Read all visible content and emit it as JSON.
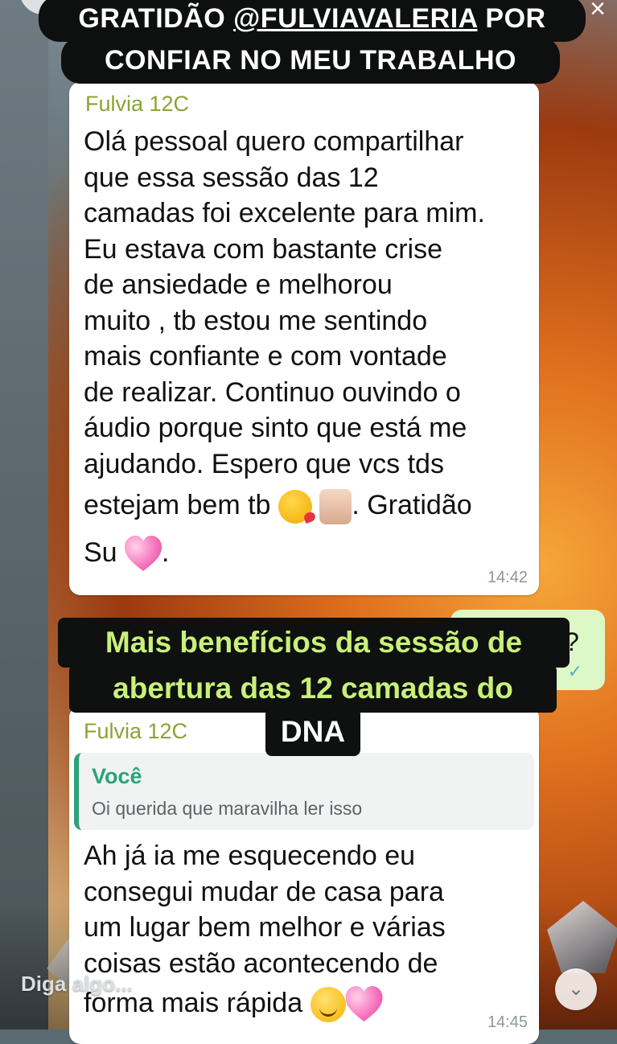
{
  "story": {
    "caption_line1_prefix": "GRATIDÃO ",
    "caption_line1_handle": "@FULVIAVALERIA",
    "caption_line1_suffix": " POR",
    "caption_line2": "CONFIAR NO MEU TRABALHO",
    "close_symbol": "×",
    "middle_caption_line1": "Mais benefícios da sessão de",
    "middle_caption_line2": "abertura das 12 camadas do",
    "middle_caption_line3": "DNA",
    "reply_placeholder": "Diga algo...",
    "scroll_down_symbol": "⌄"
  },
  "chat": {
    "message1": {
      "sender": "Fulvia 12C",
      "lines": [
        "Olá pessoal quero compartilhar",
        "que essa sessão das 12",
        "camadas foi excelente para mim.",
        "Eu estava com bastante crise",
        "de ansiedade e melhorou",
        "muito , tb estou me sentindo",
        "mais confiante e com vontade",
        "de realizar. Continuo ouvindo o",
        "áudio porque sinto que está me",
        "ajudando. Espero que vcs tds"
      ],
      "line11_before": "estejam bem tb ",
      "line11_after": ". Gratidão",
      "line12_before": "Su ",
      "line12_after": ".",
      "time": "14:42"
    },
    "outgoing_partial": {
      "tick": "✓",
      "text": "?"
    },
    "message2": {
      "sender": "Fulvia 12C",
      "quoted_name": "Você",
      "quoted_text": "Oi querida que maravilha ler isso",
      "lines": [
        "Ah já ia me esquecendo eu",
        "consegui mudar de casa para",
        "um lugar bem melhor e várias",
        "coisas estão acontecendo de"
      ],
      "line5_before": "forma mais rápida ",
      "time": "14:45"
    },
    "emoji_icons": [
      "kissing-face-icon",
      "praying-hands-icon",
      "pink-heart-icon",
      "smiling-face-icon"
    ]
  }
}
